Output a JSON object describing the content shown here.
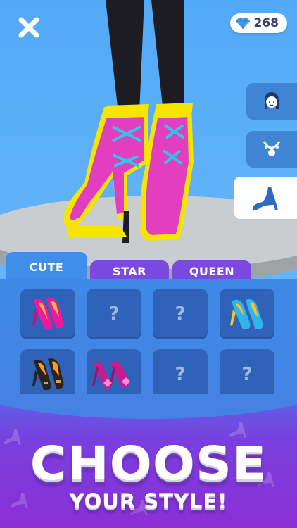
{
  "hud": {
    "close_icon": "close-icon",
    "gems": "268",
    "gem_icon": "diamond-icon"
  },
  "side_menu": [
    {
      "icon": "face-icon",
      "active": false
    },
    {
      "icon": "necklace-icon",
      "active": false
    },
    {
      "icon": "high-heel-icon",
      "active": true
    }
  ],
  "tabs": [
    {
      "label": "CUTE",
      "active": true
    },
    {
      "label": "STAR",
      "active": false
    },
    {
      "label": "QUEEN",
      "active": false
    }
  ],
  "grid": [
    {
      "type": "shoe",
      "icon": "pink-heel-icon"
    },
    {
      "type": "locked",
      "label": "?"
    },
    {
      "type": "locked",
      "label": "?"
    },
    {
      "type": "shoe",
      "icon": "blue-open-toe-heel-icon"
    },
    {
      "type": "shoe",
      "icon": "black-loafer-heel-icon"
    },
    {
      "type": "shoe",
      "icon": "pink-bow-heel-icon"
    },
    {
      "type": "locked",
      "label": "?"
    },
    {
      "type": "locked",
      "label": "?"
    }
  ],
  "banner": {
    "line1": "CHOOSE",
    "line2": "YOUR STYLE!"
  },
  "colors": {
    "sky": "#52a9f7",
    "panel": "#3d8ae6",
    "cell": "#2f63b9",
    "tab_inactive": "#7a49e0",
    "boot_pink": "#e23fc0",
    "boot_yellow": "#f5e500",
    "laces": "#2bc7e6"
  }
}
